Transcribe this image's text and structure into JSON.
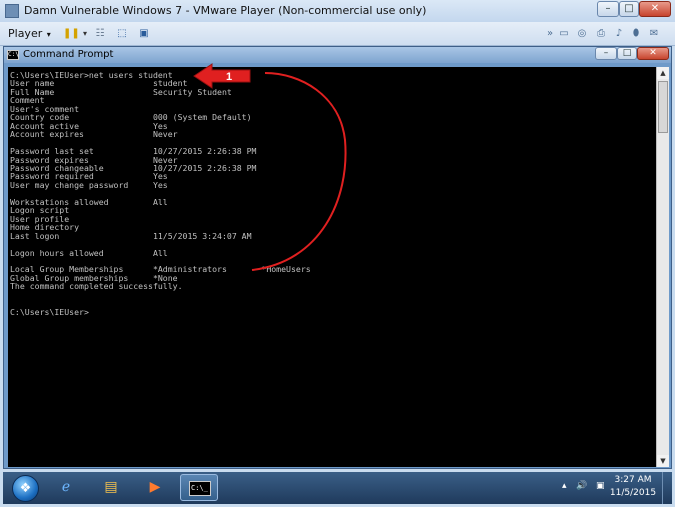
{
  "vmware": {
    "title": "Damn Vulnerable Windows 7 - VMware Player (Non-commercial use only)",
    "player_menu_label": "Player"
  },
  "window": {
    "title": "Command Prompt",
    "icon_text": "C:\\"
  },
  "console": {
    "lines": [
      "C:\\Users\\IEUser>net users student",
      "User name                    student",
      "Full Name                    Security Student",
      "Comment",
      "User's comment",
      "Country code                 000 (System Default)",
      "Account active               Yes",
      "Account expires              Never",
      "",
      "Password last set            10/27/2015 2:26:38 PM",
      "Password expires             Never",
      "Password changeable          10/27/2015 2:26:38 PM",
      "Password required            Yes",
      "User may change password     Yes",
      "",
      "Workstations allowed         All",
      "Logon script",
      "User profile",
      "Home directory",
      "Last logon                   11/5/2015 3:24:07 AM",
      "",
      "Logon hours allowed          All",
      "",
      "Local Group Memberships      *Administrators       *HomeUsers",
      "Global Group memberships     *None",
      "The command completed successfully.",
      "",
      "",
      "C:\\Users\\IEUser>"
    ]
  },
  "annotation": {
    "step_label": "1",
    "color": "#e02020"
  },
  "taskbar": {
    "clock_time": "3:27 AM",
    "clock_date": "11/5/2015",
    "cmd_app_icon_text": "C:\\_"
  },
  "icons": {
    "start": "windows-start-icon",
    "ie": "internet-explorer-icon",
    "explorer": "folder-icon",
    "media": "media-player-icon",
    "cmd": "command-prompt-icon"
  },
  "colors": {
    "console_background": "#000000",
    "console_text": "#c0c0c0",
    "accent_red": "#e02020"
  }
}
